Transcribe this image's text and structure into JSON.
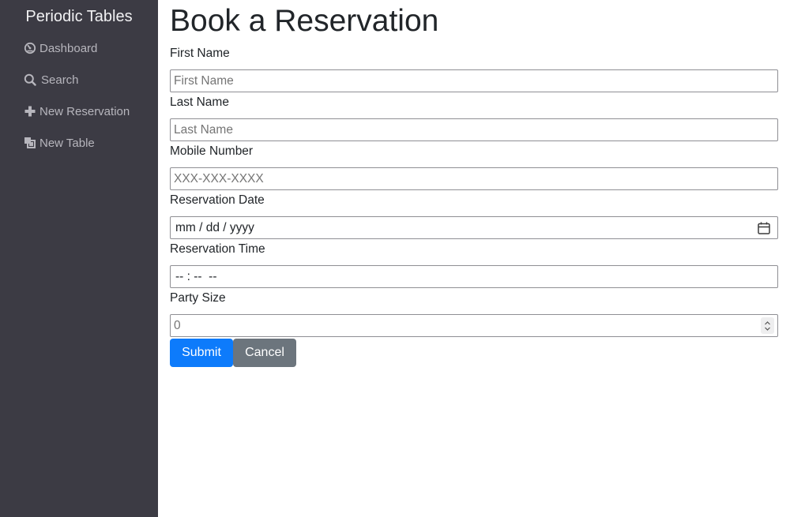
{
  "sidebar": {
    "brand": "Periodic Tables",
    "items": [
      {
        "label": "Dashboard",
        "icon": "dashboard-icon"
      },
      {
        "label": "Search",
        "icon": "search-icon"
      },
      {
        "label": "New Reservation",
        "icon": "plus-icon"
      },
      {
        "label": "New Table",
        "icon": "layers-icon"
      }
    ]
  },
  "main": {
    "title": "Book a Reservation",
    "fields": {
      "first_name": {
        "label": "First Name",
        "placeholder": "First Name",
        "value": ""
      },
      "last_name": {
        "label": "Last Name",
        "placeholder": "Last Name",
        "value": ""
      },
      "mobile_number": {
        "label": "Mobile Number",
        "placeholder": "XXX-XXX-XXXX",
        "value": ""
      },
      "reservation_date": {
        "label": "Reservation Date",
        "display": "mm / dd / yyyy",
        "icon": "calendar-icon"
      },
      "reservation_time": {
        "label": "Reservation Time",
        "display": "-- : --  --"
      },
      "party_size": {
        "label": "Party Size",
        "display": "0"
      }
    },
    "buttons": {
      "submit": "Submit",
      "cancel": "Cancel"
    }
  },
  "colors": {
    "sidebar_bg": "#3c3b44",
    "sidebar_text": "#b7b6bd",
    "brand_text": "#f1f1f3",
    "primary": "#0d7bfb",
    "secondary": "#6c757d"
  }
}
